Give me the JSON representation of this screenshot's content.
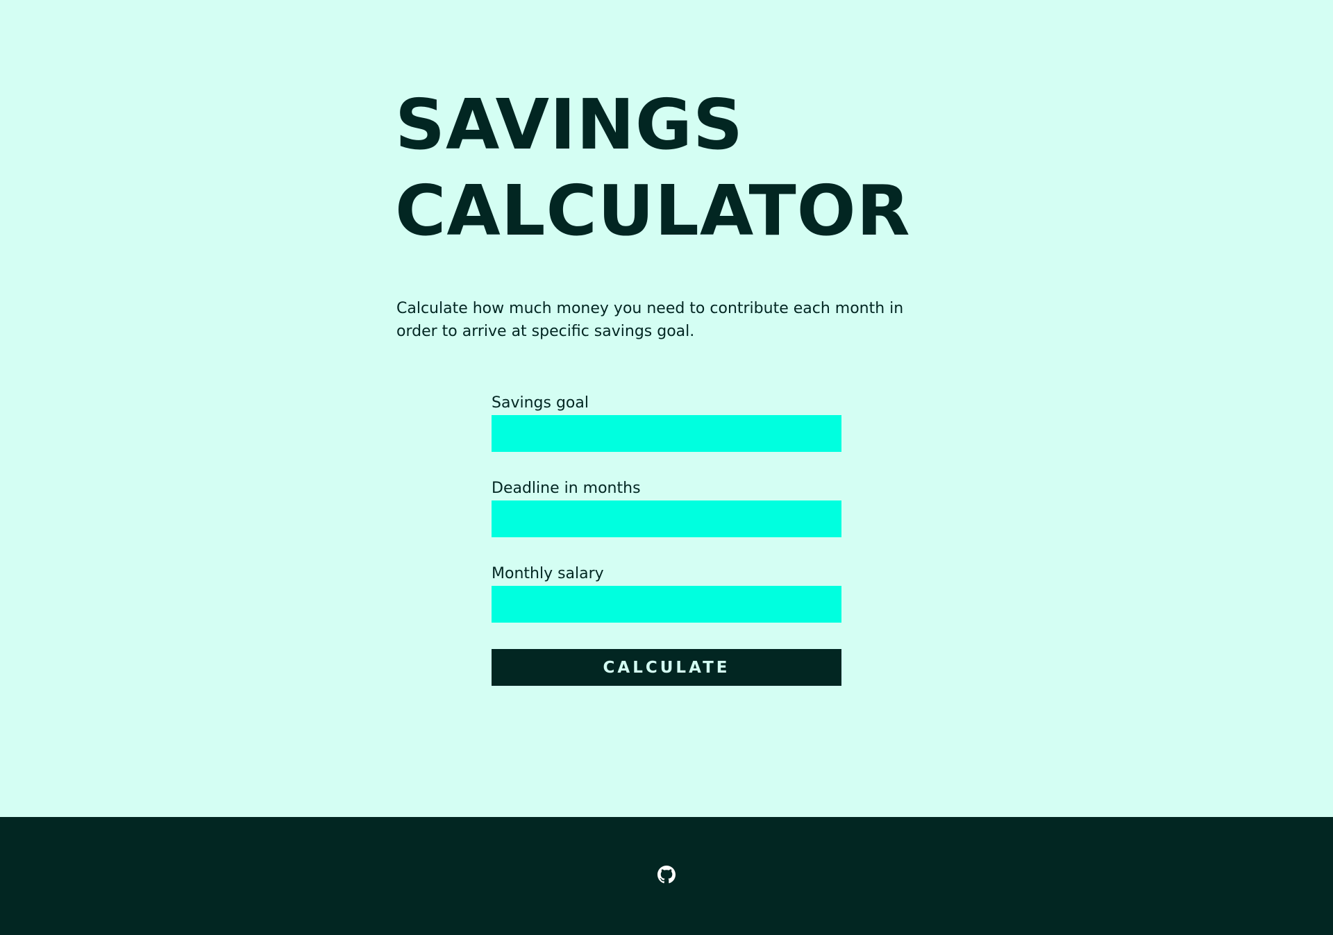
{
  "page": {
    "title_line_1": "SAVINGS",
    "title_line_2": "CALCULATOR",
    "description": "Calculate how much money you need to contribute each month in order to arrive at specific savings goal."
  },
  "form": {
    "fields": [
      {
        "label": "Savings goal",
        "value": "",
        "placeholder": ""
      },
      {
        "label": "Deadline in months",
        "value": "",
        "placeholder": ""
      },
      {
        "label": "Monthly salary",
        "value": "",
        "placeholder": ""
      }
    ],
    "submit_label": "CALCULATE"
  },
  "footer": {
    "icon": "github-icon"
  },
  "colors": {
    "background": "#d4fef3",
    "text_dark": "#022622",
    "input_fill": "#00ffdf",
    "button_fill": "#022622",
    "button_text": "#d4fef3",
    "footer_fill": "#022622",
    "footer_icon": "#ffffff"
  }
}
